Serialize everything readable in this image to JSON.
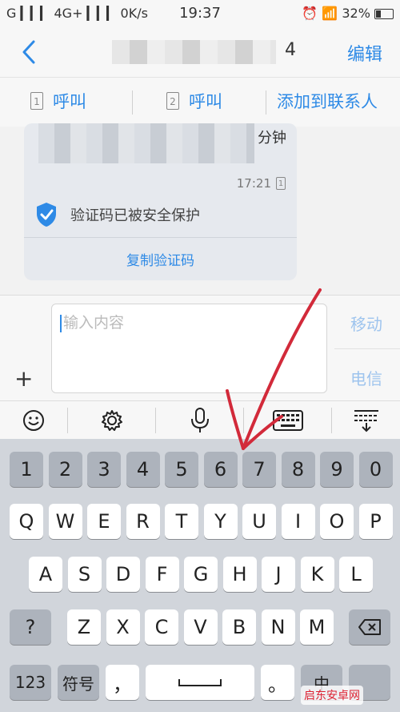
{
  "status_bar": {
    "left": "G ▎▎▎ 4G+ ▎▎▎ 0K/s",
    "time": "19:37",
    "battery": "32%"
  },
  "header": {
    "title_tail": "4",
    "edit_label": "编辑"
  },
  "actions": {
    "call1_sim": "1",
    "call1_label": "呼叫",
    "call2_sim": "2",
    "call2_label": "呼叫",
    "add_contact_label": "添加到联系人"
  },
  "message": {
    "text_tail": "分钟",
    "time": "17:21",
    "time_sim": "1",
    "secure_text": "验证码已被安全保护",
    "copy_label": "复制验证码"
  },
  "composer": {
    "placeholder": "输入内容",
    "send_mobile": "移动",
    "send_telecom": "电信"
  },
  "keyboard": {
    "row_numbers": [
      "1",
      "2",
      "3",
      "4",
      "5",
      "6",
      "7",
      "8",
      "9",
      "0"
    ],
    "row_q": [
      "Q",
      "W",
      "E",
      "R",
      "T",
      "Y",
      "U",
      "I",
      "O",
      "P"
    ],
    "row_a": [
      "A",
      "S",
      "D",
      "F",
      "G",
      "H",
      "J",
      "K",
      "L"
    ],
    "row_z": [
      "Z",
      "X",
      "C",
      "V",
      "B",
      "N",
      "M"
    ],
    "shift_label": "?",
    "k123_label": "123",
    "symbols_label": "符号",
    "comma_label": "，",
    "period_label": "。",
    "lang_label": "中"
  },
  "watermark": "启东安卓网",
  "colors": {
    "accent": "#2e8ae6",
    "arrow": "#d22a3a"
  }
}
